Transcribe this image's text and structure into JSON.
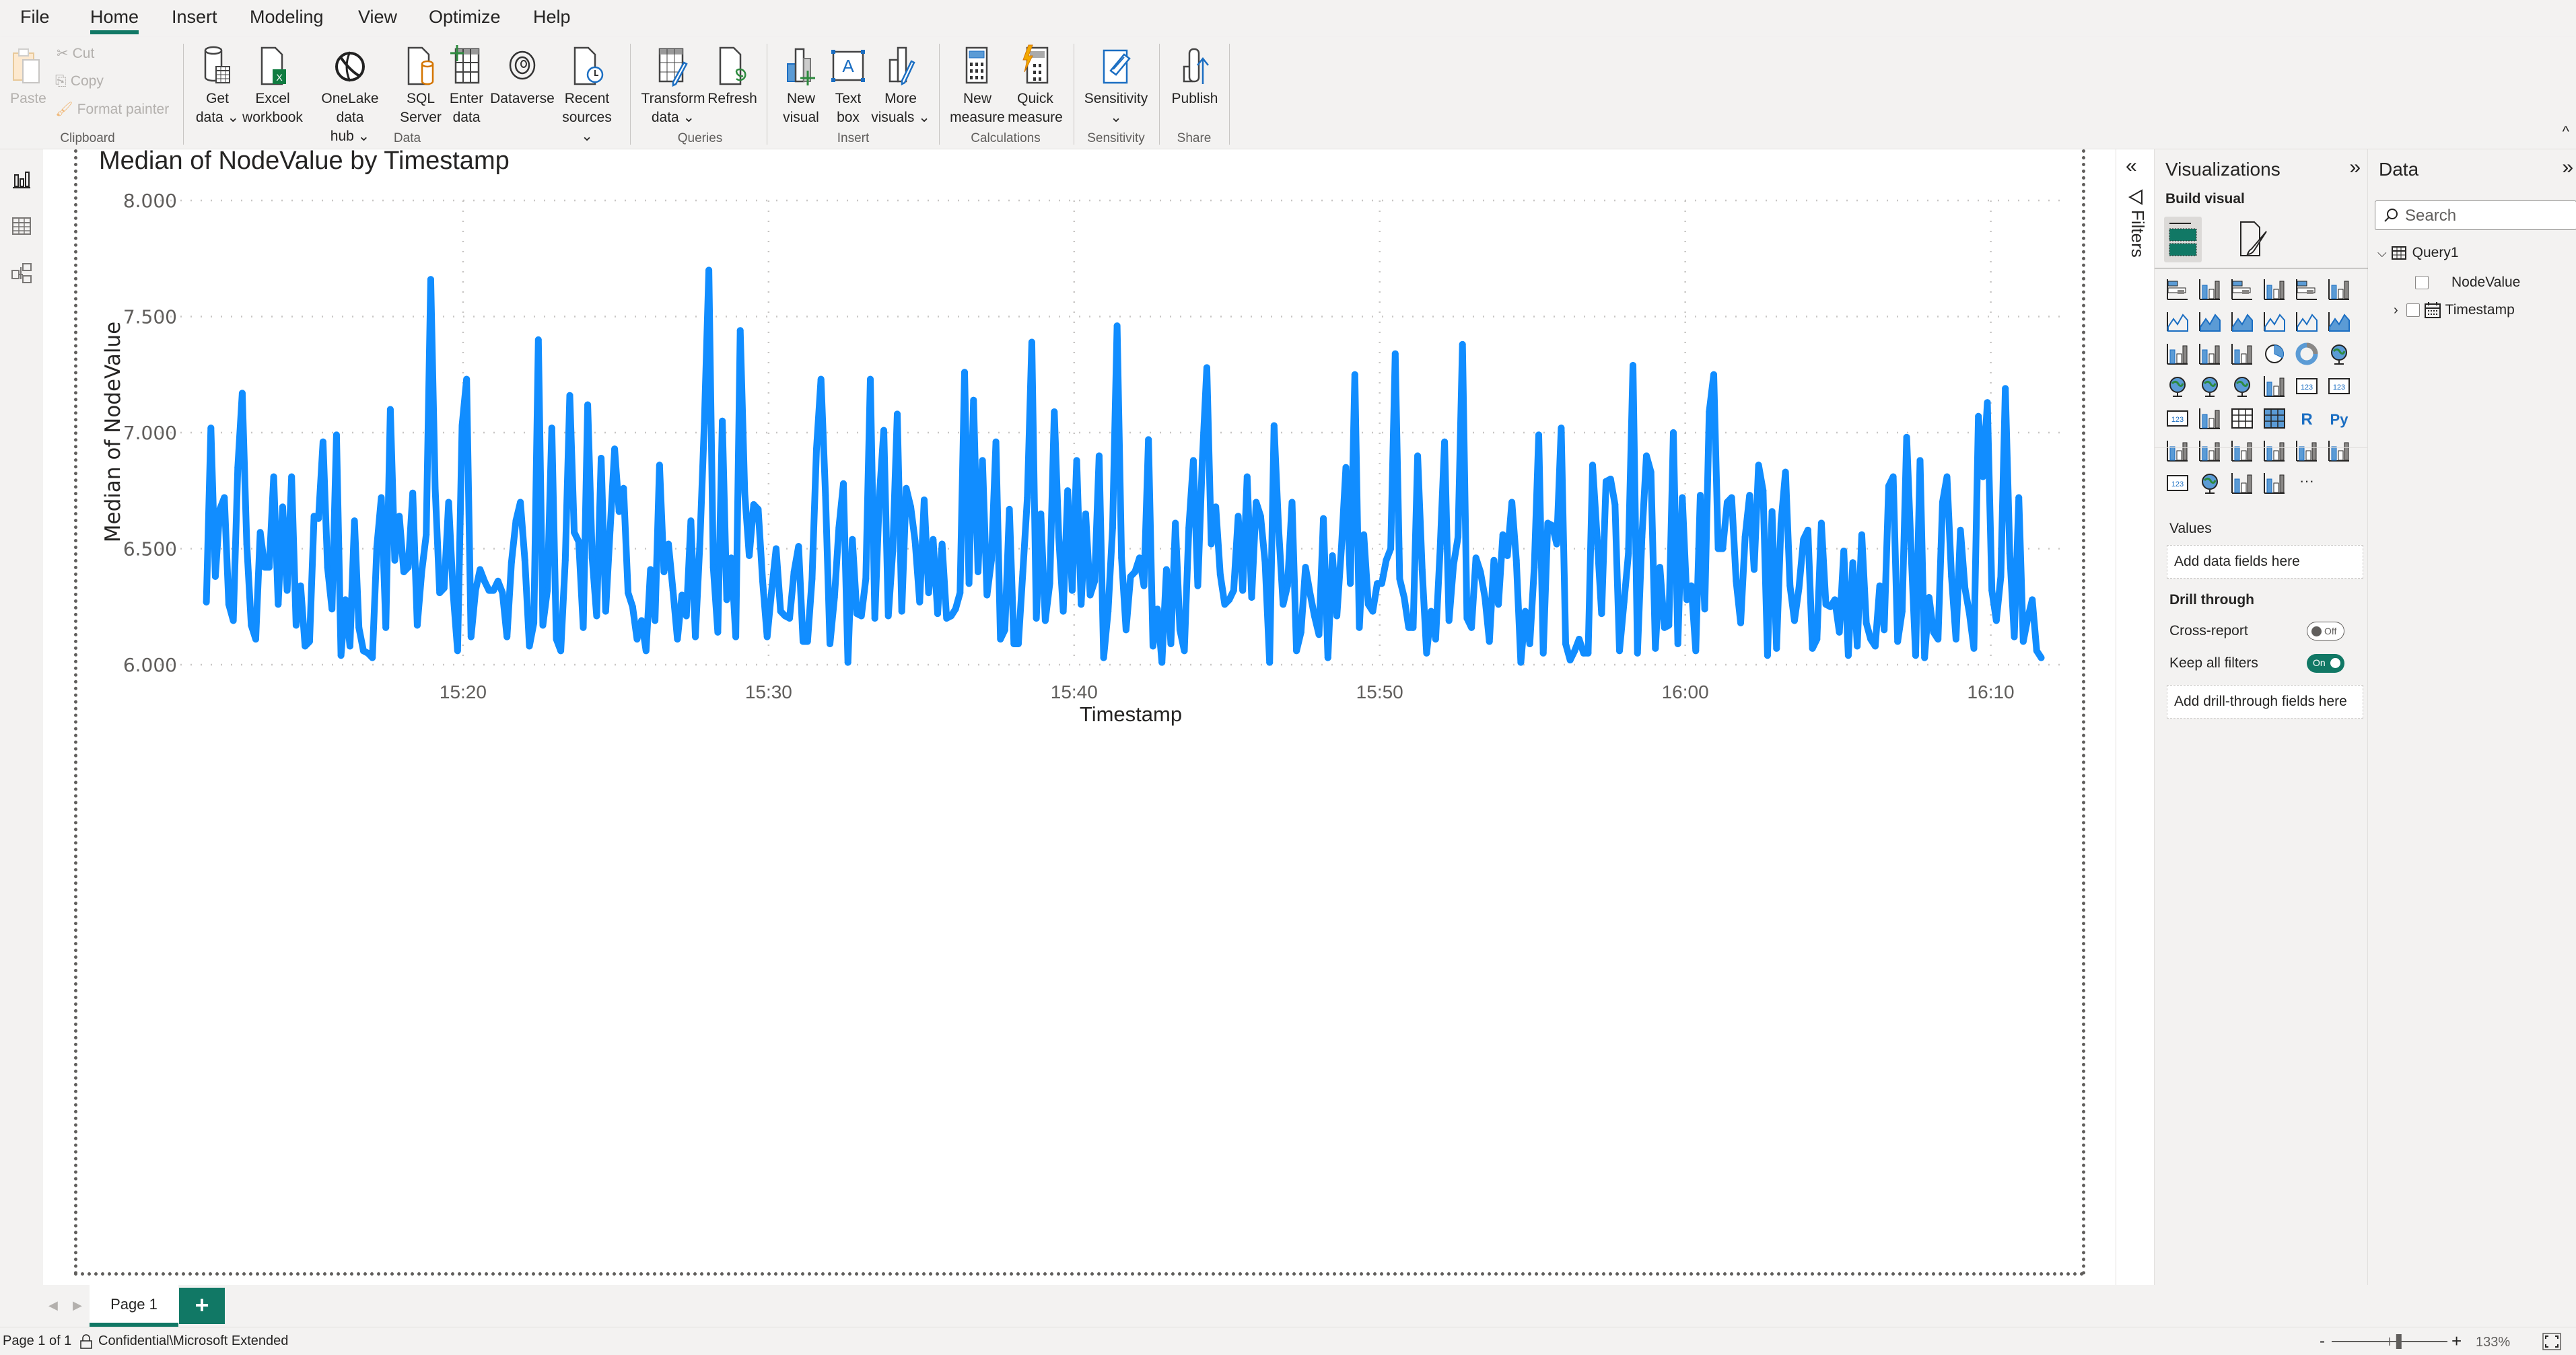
{
  "menu": {
    "tabs": [
      "File",
      "Home",
      "Insert",
      "Modeling",
      "View",
      "Optimize",
      "Help"
    ],
    "active": "Home"
  },
  "ribbon": {
    "clipboard": {
      "label": "Clipboard",
      "paste": "Paste",
      "cut": "Cut",
      "copy": "Copy",
      "format_painter": "Format painter"
    },
    "data": {
      "label": "Data",
      "get_data": [
        "Get",
        "data ⌄"
      ],
      "excel": [
        "Excel",
        "workbook"
      ],
      "onelake": [
        "OneLake data",
        "hub ⌄"
      ],
      "sql": [
        "SQL",
        "Server"
      ],
      "enter_data": [
        "Enter",
        "data"
      ],
      "dataverse": [
        "Dataverse",
        ""
      ],
      "recent": [
        "Recent",
        "sources ⌄"
      ]
    },
    "queries": {
      "label": "Queries",
      "transform": [
        "Transform",
        "data ⌄"
      ],
      "refresh": [
        "Refresh",
        ""
      ]
    },
    "insert": {
      "label": "Insert",
      "new_visual": [
        "New",
        "visual"
      ],
      "text_box": [
        "Text",
        "box"
      ],
      "more_visuals": [
        "More",
        "visuals ⌄"
      ]
    },
    "calculations": {
      "label": "Calculations",
      "new_measure": [
        "New",
        "measure"
      ],
      "quick_measure": [
        "Quick",
        "measure"
      ]
    },
    "sensitivity": {
      "label": "Sensitivity",
      "button": [
        "Sensitivity",
        "⌄"
      ]
    },
    "share": {
      "label": "Share",
      "publish": [
        "Publish",
        ""
      ]
    },
    "collapse_icon": "^"
  },
  "visual": {
    "title": "Median of NodeValue by Timestamp"
  },
  "chart_data": {
    "type": "line",
    "title": "Median of NodeValue by Timestamp",
    "xlabel": "Timestamp",
    "ylabel": "Median of NodeValue",
    "x_ticks": [
      "15:20",
      "15:30",
      "15:40",
      "15:50",
      "16:00",
      "16:10"
    ],
    "x_tick_minutes": [
      920,
      930,
      940,
      950,
      960,
      970
    ],
    "x_range_minutes": [
      911.3,
      972.3
    ],
    "x_start": "15:11:42",
    "x_end": "16:11:32",
    "y_ticks": [
      "6.000",
      "6.500",
      "7.000",
      "7.500",
      "8.000"
    ],
    "y_tick_values": [
      6.0,
      6.5,
      7.0,
      7.5,
      8.0
    ],
    "ylim": [
      6.0,
      8.0
    ],
    "grid": true,
    "legend": "none",
    "line_color": "#118DFF",
    "series": [
      {
        "name": "Median of NodeValue",
        "values": [
          6.27,
          7.02,
          6.38,
          6.67,
          6.72,
          6.26,
          6.19,
          6.85,
          7.17,
          6.52,
          6.17,
          6.11,
          6.57,
          6.42,
          6.42,
          6.81,
          6.26,
          6.68,
          6.32,
          6.81,
          6.17,
          6.34,
          6.08,
          6.1,
          6.64,
          6.63,
          6.96,
          6.42,
          6.24,
          6.99,
          6.04,
          6.28,
          6.08,
          6.62,
          6.16,
          6.06,
          6.05,
          6.03,
          6.51,
          6.72,
          6.16,
          7.1,
          6.45,
          6.64,
          6.4,
          6.42,
          6.74,
          6.17,
          6.4,
          6.56,
          7.66,
          6.76,
          6.31,
          6.33,
          6.7,
          6.31,
          6.06,
          7.03,
          7.23,
          6.12,
          6.32,
          6.41,
          6.36,
          6.32,
          6.32,
          6.36,
          6.31,
          6.12,
          6.44,
          6.62,
          6.7,
          6.45,
          6.08,
          6.18,
          7.4,
          6.17,
          6.32,
          7.02,
          6.11,
          6.06,
          6.45,
          7.16,
          6.57,
          6.53,
          6.16,
          7.12,
          6.46,
          6.21,
          6.89,
          6.23,
          6.58,
          6.93,
          6.66,
          6.76,
          6.31,
          6.25,
          6.11,
          6.19,
          6.06,
          6.41,
          6.19,
          6.86,
          6.4,
          6.52,
          6.32,
          6.11,
          6.3,
          6.21,
          6.62,
          6.12,
          6.52,
          7.04,
          7.7,
          6.42,
          6.14,
          7.05,
          6.28,
          6.46,
          6.12,
          7.44,
          6.74,
          6.47,
          6.69,
          6.67,
          6.36,
          6.12,
          6.32,
          6.5,
          6.23,
          6.21,
          6.2,
          6.4,
          6.51,
          6.1,
          6.1,
          6.37,
          6.93,
          7.23,
          6.73,
          6.09,
          6.29,
          6.59,
          6.78,
          6.01,
          6.54,
          6.22,
          6.21,
          6.37,
          7.23,
          6.2,
          6.72,
          7.01,
          6.21,
          6.49,
          7.08,
          6.23,
          6.76,
          6.68,
          6.53,
          6.27,
          6.71,
          6.31,
          6.54,
          6.22,
          6.52,
          6.2,
          6.21,
          6.24,
          6.31,
          7.26,
          6.35,
          7.14,
          6.4,
          6.88,
          6.3,
          6.45,
          6.96,
          6.11,
          6.15,
          6.67,
          6.09,
          6.09,
          6.4,
          6.72,
          7.39,
          6.2,
          6.65,
          6.19,
          6.35,
          7.09,
          6.55,
          6.23,
          6.75,
          6.32,
          6.88,
          6.26,
          6.65,
          6.3,
          6.36,
          6.9,
          6.03,
          6.23,
          6.59,
          7.46,
          6.46,
          6.15,
          6.38,
          6.4,
          6.46,
          6.34,
          6.97,
          6.08,
          6.24,
          6.01,
          6.41,
          6.09,
          6.61,
          6.15,
          6.06,
          6.59,
          6.88,
          6.34,
          6.88,
          7.28,
          6.52,
          6.68,
          6.39,
          6.26,
          6.28,
          6.32,
          6.64,
          6.32,
          6.81,
          6.29,
          6.7,
          6.64,
          6.44,
          6.01,
          7.03,
          6.59,
          6.26,
          6.34,
          6.7,
          6.06,
          6.14,
          6.42,
          6.31,
          6.21,
          6.13,
          6.63,
          6.03,
          6.47,
          6.21,
          6.5,
          6.85,
          6.35,
          7.25,
          6.16,
          6.56,
          6.26,
          6.23,
          6.35,
          6.35,
          6.45,
          6.5,
          7.34,
          6.37,
          6.29,
          6.16,
          6.16,
          6.9,
          6.41,
          6.05,
          6.23,
          6.11,
          6.49,
          6.96,
          6.19,
          6.43,
          6.55,
          7.38,
          6.2,
          6.16,
          6.46,
          6.4,
          6.29,
          6.1,
          6.45,
          6.26,
          6.56,
          6.47,
          6.7,
          6.45,
          6.01,
          6.23,
          6.09,
          6.42,
          6.99,
          6.05,
          6.61,
          6.6,
          6.52,
          7.02,
          6.09,
          6.02,
          6.06,
          6.11,
          6.05,
          6.05,
          6.86,
          6.55,
          6.22,
          6.79,
          6.8,
          6.69,
          6.06,
          6.27,
          6.48,
          7.29,
          6.05,
          6.55,
          6.9,
          6.83,
          6.07,
          6.42,
          6.16,
          6.17,
          7.0,
          6.09,
          6.72,
          6.28,
          6.34,
          6.06,
          6.73,
          6.24,
          7.09,
          7.25,
          6.5,
          6.5,
          6.7,
          6.72,
          6.36,
          6.18,
          6.55,
          6.73,
          6.41,
          6.86,
          6.75,
          6.04,
          6.66,
          6.07,
          6.61,
          6.83,
          6.34,
          6.19,
          6.33,
          6.54,
          6.58,
          6.07,
          6.11,
          6.61,
          6.26,
          6.25,
          6.28,
          6.14,
          6.49,
          6.04,
          6.44,
          6.08,
          6.56,
          6.18,
          6.11,
          6.08,
          6.34,
          6.15,
          6.77,
          6.81,
          6.1,
          6.23,
          6.98,
          6.49,
          6.04,
          6.88,
          6.03,
          6.29,
          6.14,
          6.11,
          6.7,
          6.81,
          6.38,
          6.11,
          6.58,
          6.33,
          6.22,
          6.07,
          7.07,
          6.81,
          7.13,
          6.32,
          6.19,
          6.38,
          7.19,
          6.48,
          6.12,
          6.72,
          6.1,
          6.2,
          6.28,
          6.06,
          6.03
        ]
      }
    ]
  },
  "left_nav": {
    "items": [
      "report-view",
      "table-view",
      "model-view"
    ]
  },
  "filters": {
    "label": "Filters",
    "collapse_icon": "«"
  },
  "visualizations": {
    "title": "Visualizations",
    "expand_icon": "»",
    "build_visual": "Build visual",
    "icons": [
      "stacked-bar-chart",
      "stacked-column-chart",
      "clustered-bar-chart",
      "clustered-column-chart",
      "100-stacked-bar-chart",
      "100-stacked-column-chart",
      "line-chart",
      "area-chart",
      "stacked-area-chart",
      "line-and-stacked-column-chart",
      "line-and-clustered-column-chart",
      "ribbon-chart",
      "waterfall-chart",
      "funnel-chart",
      "scatter-chart",
      "pie-chart",
      "donut-chart",
      "treemap",
      "map",
      "filled-map",
      "azure-map",
      "gauge",
      "card",
      "multi-row-card",
      "kpi",
      "slicer",
      "table",
      "matrix",
      "r-script-visual",
      "python-visual",
      "key-influencers",
      "decomposition-tree",
      "qa",
      "smart-narrative",
      "metrics",
      "paginated-report",
      "power-automate-card",
      "arcgis-map",
      "power-apps",
      "power-automate",
      "more-visuals"
    ],
    "values_label": "Values",
    "values_placeholder": "Add data fields here",
    "drill_through_label": "Drill through",
    "cross_report_label": "Cross-report",
    "cross_report_state": "Off",
    "keep_all_filters_label": "Keep all filters",
    "keep_all_filters_state": "On",
    "drill_through_placeholder": "Add drill-through fields here"
  },
  "data_pane": {
    "title": "Data",
    "expand_icon": "»",
    "search_placeholder": "Search",
    "table_name": "Query1",
    "fields": [
      {
        "name": "NodeValue",
        "checked": false
      },
      {
        "name": "Timestamp",
        "checked": false,
        "expandable": true
      }
    ]
  },
  "pages": {
    "tabs": [
      "Page 1"
    ],
    "add_label": "+"
  },
  "status": {
    "page_info": "Page 1 of 1",
    "sensitivity": "Confidential\\Microsoft Extended",
    "zoom_minus": "-",
    "zoom_plus": "+",
    "zoom_level": "133%",
    "zoom_fraction": 0.58
  },
  "colors": {
    "accent": "#117865",
    "line": "#118DFF",
    "background": "#F3F2F1"
  }
}
